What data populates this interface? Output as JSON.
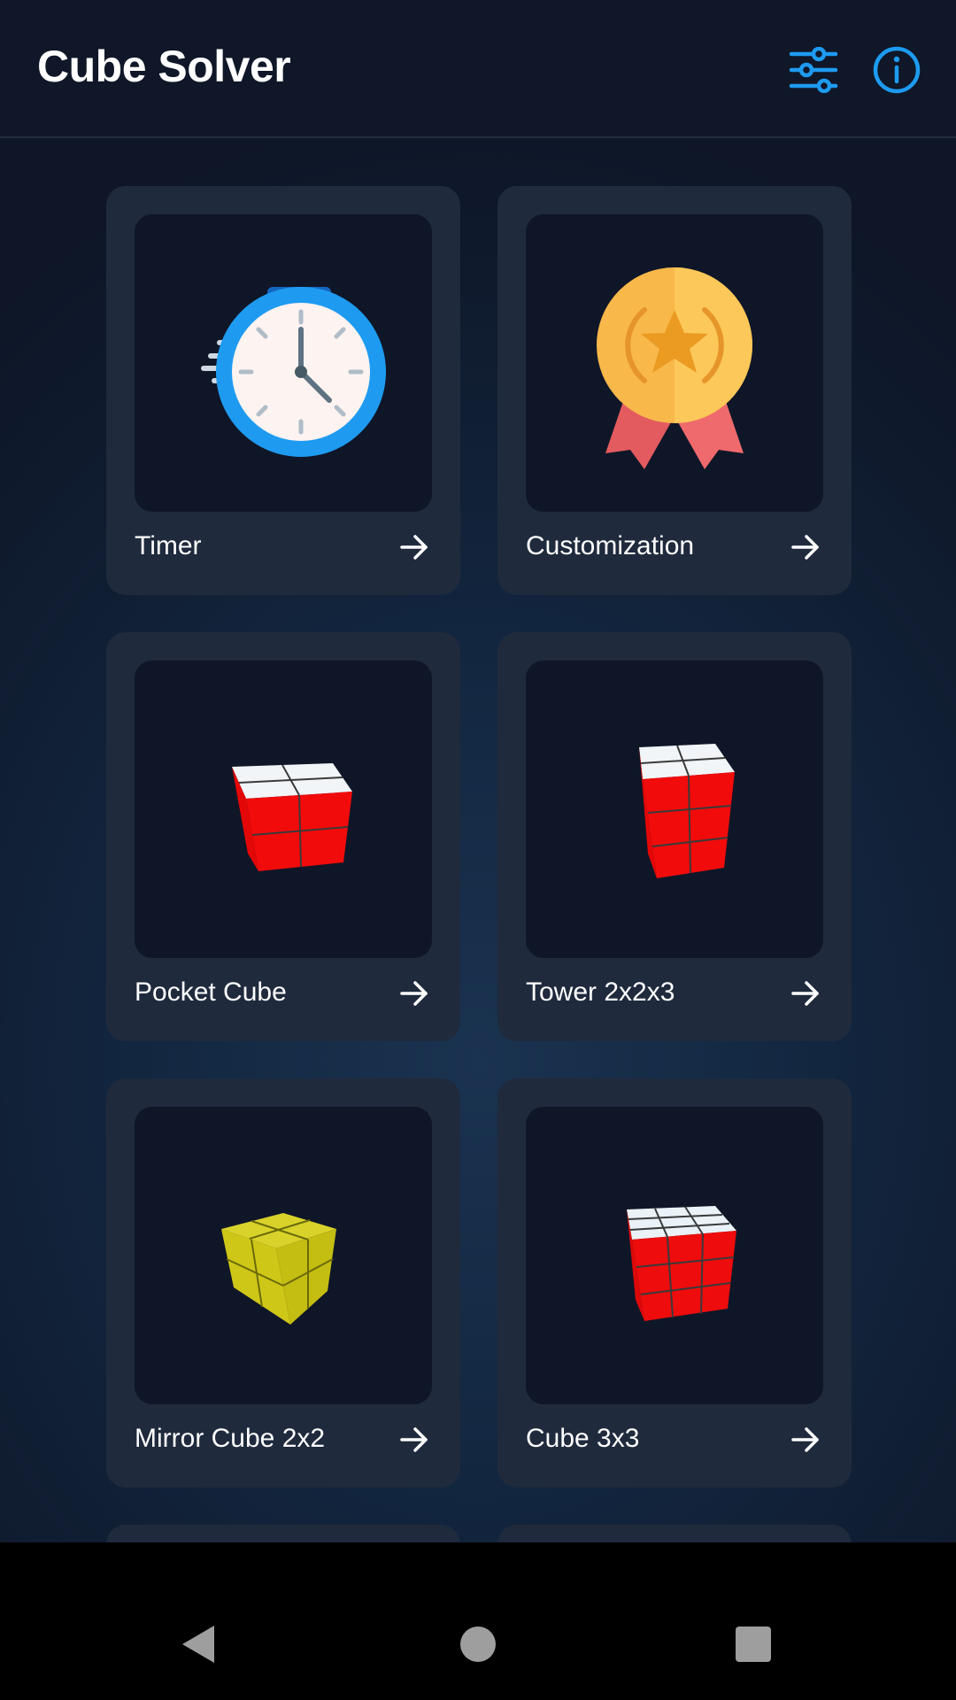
{
  "app": {
    "title": "Cube Solver",
    "accent_color": "#1e9bf0",
    "settings_icon": "tune-sliders-icon",
    "info_icon": "info-circle-icon"
  },
  "cards": [
    {
      "label": "Timer",
      "image": "stopwatch-illustration"
    },
    {
      "label": "Customization",
      "image": "gold-medal-illustration"
    },
    {
      "label": "Pocket Cube",
      "image": "cube-2x2-render"
    },
    {
      "label": "Tower 2x2x3",
      "image": "cube-2x2x3-render"
    },
    {
      "label": "Mirror Cube 2x2",
      "image": "mirror-cube-render"
    },
    {
      "label": "Cube 3x3",
      "image": "cube-3x3-render"
    }
  ],
  "card_arrow_icon": "arrow-right-icon",
  "navigation": {
    "back": "back-triangle-icon",
    "home": "home-circle-icon",
    "recents": "recents-square-icon"
  }
}
